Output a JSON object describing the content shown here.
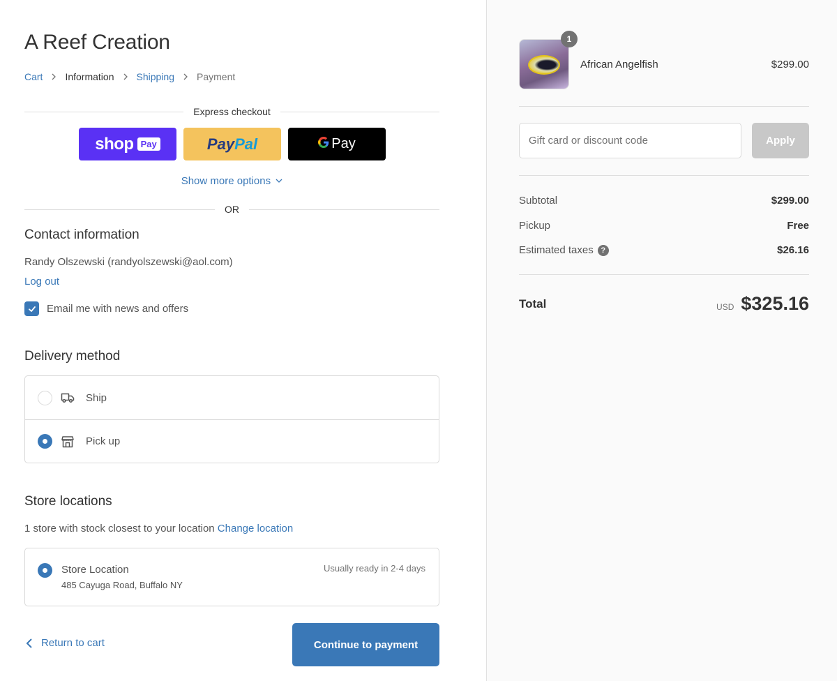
{
  "store": {
    "title": "A Reef Creation"
  },
  "breadcrumb": [
    {
      "label": "Cart",
      "state": "link"
    },
    {
      "label": "Information",
      "state": "current"
    },
    {
      "label": "Shipping",
      "state": "link"
    },
    {
      "label": "Payment",
      "state": "disabled"
    }
  ],
  "express": {
    "title": "Express checkout",
    "shop_pay": {
      "word": "shop",
      "badge": "Pay"
    },
    "paypal": {
      "part1": "Pay",
      "part2": "Pal"
    },
    "gpay": {
      "g": "G",
      "label": "Pay"
    },
    "show_more": "Show more options",
    "or": "OR"
  },
  "contact": {
    "title": "Contact information",
    "user": "Randy Olszewski (randyolszewski@aol.com)",
    "logout": "Log out",
    "email_opt_label": "Email me with news and offers",
    "email_opt_checked": true
  },
  "delivery": {
    "title": "Delivery method",
    "options": [
      {
        "label": "Ship",
        "icon": "truck-icon",
        "selected": false
      },
      {
        "label": "Pick up",
        "icon": "store-icon",
        "selected": true
      }
    ]
  },
  "store_locations": {
    "title": "Store locations",
    "subtitle": "1 store with stock closest to your location",
    "change_link": "Change location",
    "locations": [
      {
        "name": "Store Location",
        "address": "485 Cayuga Road, Buffalo NY",
        "ready": "Usually ready in 2-4 days",
        "selected": true
      }
    ]
  },
  "footer": {
    "return_label": "Return to cart",
    "continue_label": "Continue to payment"
  },
  "colors": {
    "accent": "#3a78b7",
    "shop_pay": "#5a31f4",
    "paypal": "#f4c35d",
    "sidebar_bg": "#fafafa"
  },
  "summary": {
    "product": {
      "name": "African Angelfish",
      "price": "$299.00",
      "quantity": "1"
    },
    "discount": {
      "placeholder": "Gift card or discount code",
      "value": "",
      "apply_label": "Apply"
    },
    "lines": [
      {
        "label": "Subtotal",
        "value": "$299.00"
      },
      {
        "label": "Pickup",
        "value": "Free"
      },
      {
        "label": "Estimated taxes",
        "value": "$26.16"
      }
    ],
    "total": {
      "label": "Total",
      "currency": "USD",
      "amount": "$325.16"
    }
  }
}
